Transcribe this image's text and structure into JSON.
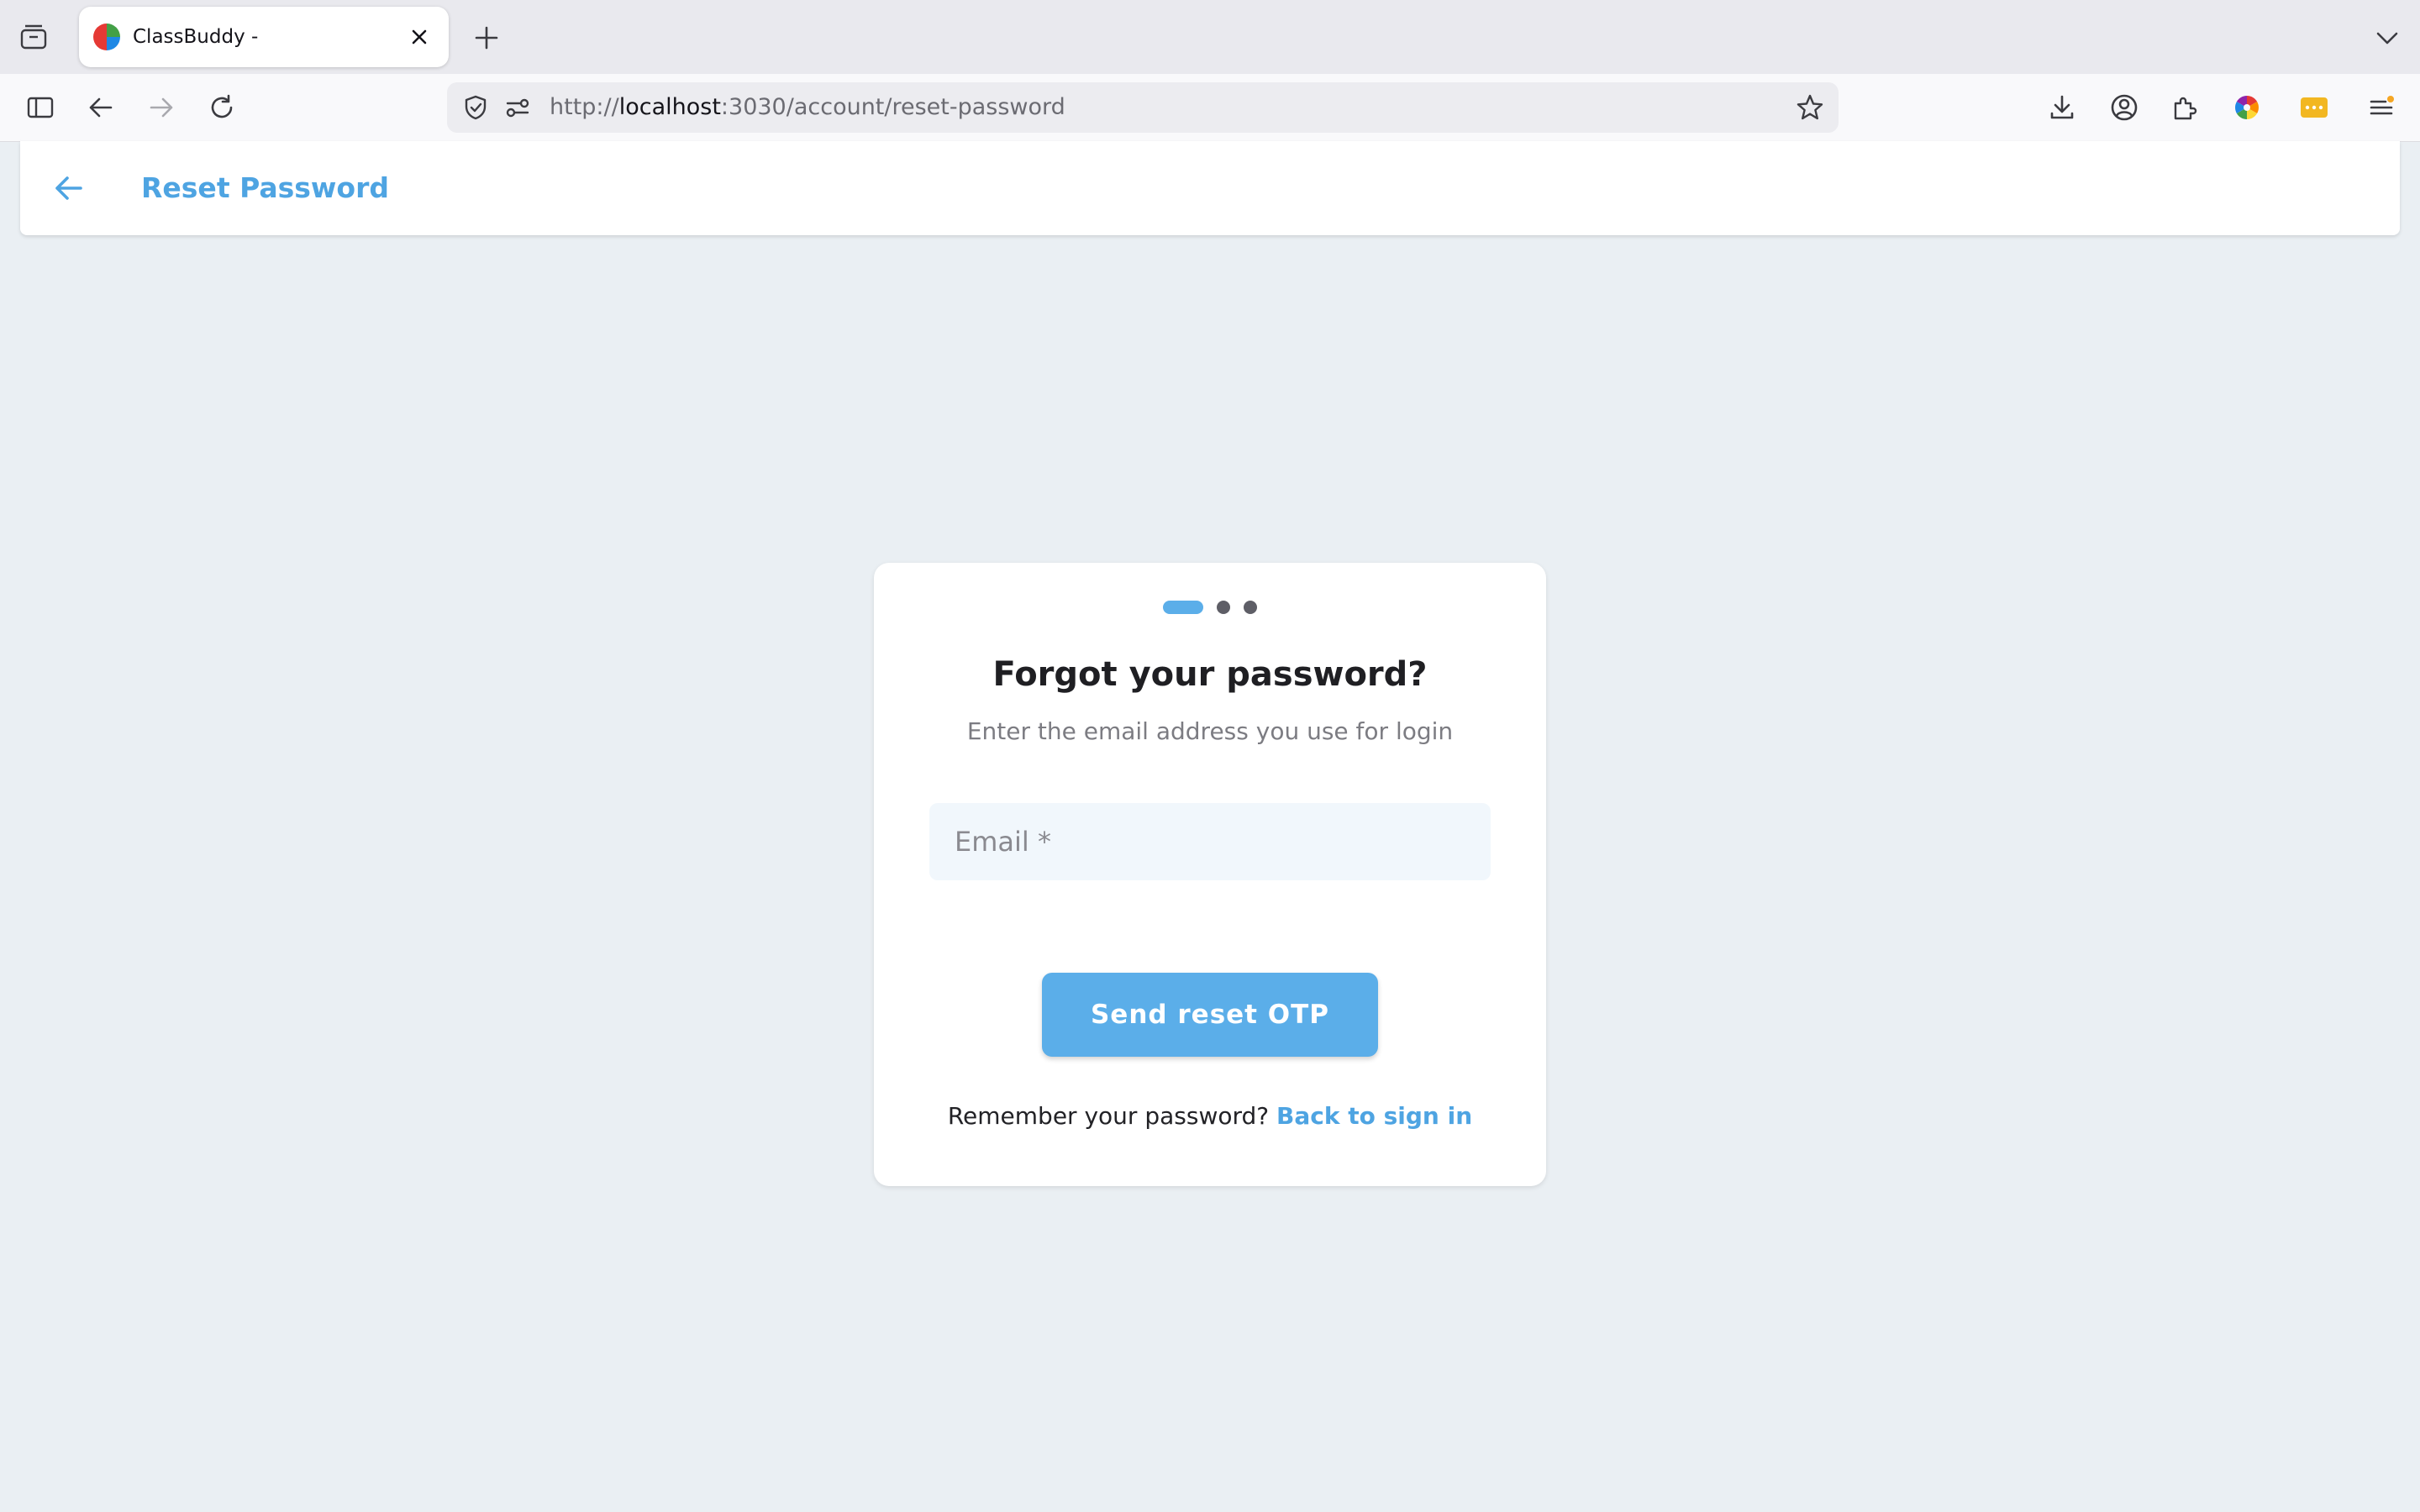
{
  "browser": {
    "tab": {
      "title": "ClassBuddy -"
    },
    "url": {
      "scheme": "http://",
      "host": "localhost",
      "rest": ":3030/account/reset-password"
    },
    "icons": {
      "tab_list": "tab-list-icon",
      "favicon": "classbuddy-favicon",
      "close": "close-icon",
      "new_tab": "plus-icon",
      "overflow": "chevron-down-icon",
      "sidebar": "sidebar-icon",
      "back": "arrow-left-icon",
      "forward": "arrow-right-icon",
      "reload": "reload-icon",
      "shield": "shield-icon",
      "permissions": "permissions-icon",
      "bookmark": "star-icon",
      "downloads": "download-icon",
      "account": "account-icon",
      "extensions": "puzzle-icon",
      "color_extension": "color-wheel-icon",
      "password_extension": "password-manager-icon",
      "menu": "hamburger-menu-icon"
    }
  },
  "header": {
    "title": "Reset Password"
  },
  "card": {
    "stepper": {
      "total_steps": 3,
      "current_step": 1
    },
    "title": "Forgot your password?",
    "subtitle": "Enter the email address you use for login",
    "email": {
      "value": "",
      "placeholder": "Email *"
    },
    "submit_label": "Send reset OTP",
    "footer_text": "Remember your password?",
    "footer_link": "Back to sign in"
  },
  "colors": {
    "accent": "#5baee9",
    "link": "#4ea4e2",
    "page_background": "#eaeff3",
    "card_background": "#ffffff",
    "input_background": "#f1f7fc",
    "inactive_step": "#5e5e66"
  }
}
